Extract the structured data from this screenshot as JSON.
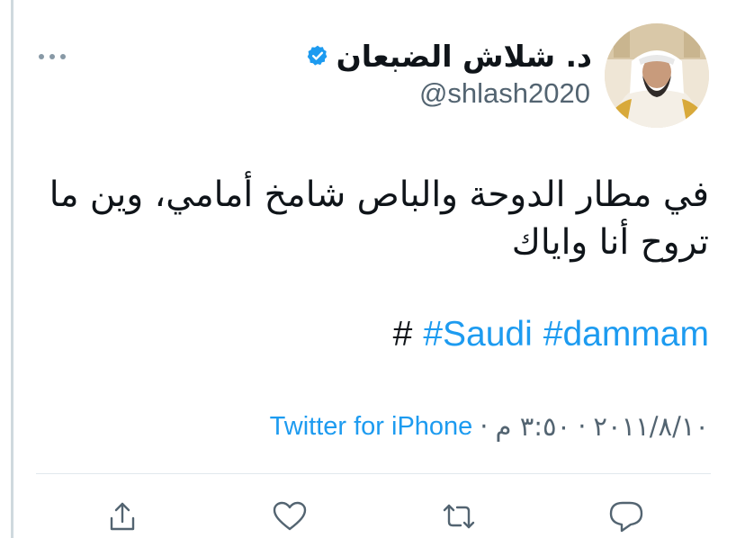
{
  "tweet": {
    "author": {
      "display_name": "د. شلاش الضبعان",
      "handle": "@shlash2020",
      "verified": true,
      "avatar": "profile-photo"
    },
    "text": "في مطار الدوحة والباص شامخ أمامي، وين ما تروح أنا واياك",
    "hashtags": [
      "#Saudi",
      "#dammam"
    ],
    "trailing_hash": "#",
    "date": "٢٠١١/٨/١٠",
    "time": "٣:٥٠ م",
    "separator": "·",
    "source": "Twitter for iPhone"
  },
  "icons": {
    "more": "more-horizontal-icon",
    "share": "share-icon",
    "like": "heart-icon",
    "retweet": "retweet-icon",
    "reply": "reply-icon",
    "verified": "verified-badge-icon"
  },
  "colors": {
    "accent": "#1d9bf0",
    "text": "#0f1419",
    "secondary": "#536471",
    "divider": "#e1e8ed"
  }
}
